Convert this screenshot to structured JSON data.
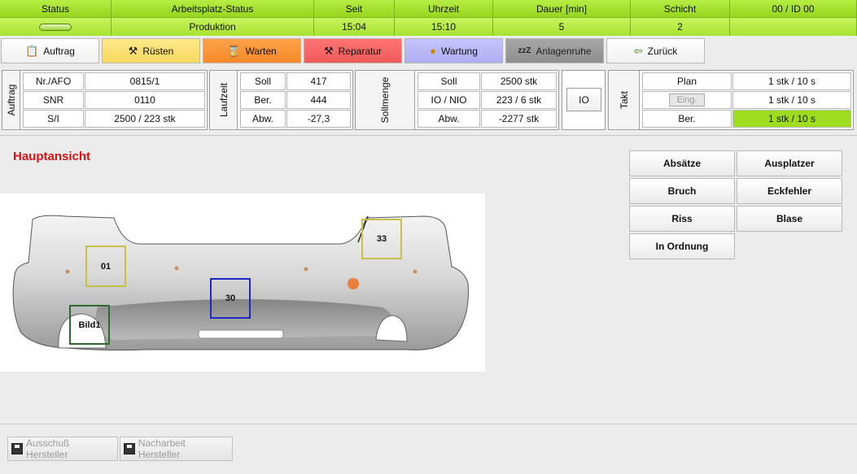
{
  "status_bar": {
    "headers": [
      "Status",
      "Arbeitsplatz-Status",
      "Seit",
      "Uhrzeit",
      "Dauer [min]",
      "Schicht",
      "00  / ID 00"
    ],
    "values": [
      "",
      "Produktion",
      "15:04",
      "15:10",
      "5",
      "2",
      ""
    ]
  },
  "toolbar": {
    "auftrag": "Auftrag",
    "ruesten": "Rüsten",
    "warten": "Warten",
    "reparatur": "Reparatur",
    "wartung": "Wartung",
    "anlagenruhe": "Anlagenruhe",
    "zurueck": "Zurück",
    "anlagenruhe_glyph": "zzZ"
  },
  "auftrag_panel": {
    "label": "Auftrag",
    "rows": [
      [
        "Nr./AFO",
        "0815/1"
      ],
      [
        "SNR",
        "0110"
      ],
      [
        "S/I",
        "2500  / 223 stk"
      ]
    ]
  },
  "laufzeit_panel": {
    "label": "Laufzeit",
    "rows": [
      [
        "Soll",
        "417"
      ],
      [
        "Ber.",
        "444"
      ],
      [
        "Abw.",
        "-27,3"
      ]
    ]
  },
  "sollmenge_panel": {
    "label": "Sollmenge",
    "rows": [
      [
        "Soll",
        "2500 stk"
      ],
      [
        "IO / NIO",
        "223  / 6 stk"
      ],
      [
        "Abw.",
        "-2277 stk"
      ]
    ]
  },
  "io_button": "IO",
  "takt_panel": {
    "label": "Takt",
    "rows": [
      [
        "Plan",
        "1 stk  / 10 s"
      ],
      [
        "Eing.",
        "1 stk  / 10 s"
      ],
      [
        "Ber.",
        "1   stk  / 10 s"
      ]
    ]
  },
  "main_title": "Hauptansicht",
  "image_markers": [
    "01",
    "30",
    "33",
    "Bild1"
  ],
  "defect_buttons": [
    "Absätze",
    "Ausplatzer",
    "Bruch",
    "Eckfehler",
    "Riss",
    "Blase",
    "In Ordnung"
  ],
  "bottom_buttons": [
    "Ausschuß Hersteller",
    "Nacharbeit Hersteller"
  ],
  "colors": {
    "status_green": "#a9e232",
    "title_red": "#dd1111",
    "highlight_green": "#9ddc1e",
    "marker_yellow": "#c9c04a",
    "marker_blue": "#1a28c8",
    "marker_green": "#2d6a2d"
  }
}
